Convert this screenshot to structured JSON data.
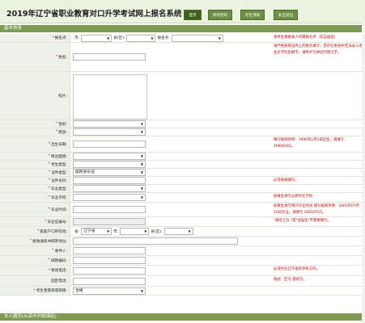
{
  "header": {
    "title": "2019年辽宁省职业教育对口升学考试网上报名系统",
    "nav": [
      "首页",
      "修改密码",
      "考生须知",
      "安全退出"
    ]
  },
  "sections": {
    "basic": "基本信息",
    "resume": "本人履历(从高中开始填起)"
  },
  "fields": {
    "site": {
      "label": "报名点:",
      "city_label": "市:",
      "county_label": "县(区):",
      "point_label": "报名点:"
    },
    "name": {
      "label": "姓名:"
    },
    "photo": {
      "label": "照片:"
    },
    "gender": {
      "label": "性别:"
    },
    "ethnicity": {
      "label": "民族:"
    },
    "birth": {
      "label": "出生日期:"
    },
    "politics": {
      "label": "政治面貌:"
    },
    "candidate_type": {
      "label": "考生类型:"
    },
    "id_type": {
      "label": "证件类型:",
      "value": "居民身份证"
    },
    "id_number": {
      "label": "证件号码:"
    },
    "grad_type": {
      "label": "毕业类型:"
    },
    "grad_school": {
      "label": "毕业学校:"
    },
    "grad_time": {
      "label": "毕业时间:"
    },
    "grad_cert": {
      "label": "毕业证编号:"
    },
    "hukou": {
      "label": "家庭户口所在地:",
      "province": "省:",
      "province_value": "辽宁省",
      "city_label": "市:",
      "county_label": "县(区):"
    },
    "address": {
      "label": "接收通知书邮寄地址:"
    },
    "recipient": {
      "label": "收件人:"
    },
    "postcode": {
      "label": "邮政编码:"
    },
    "mobile": {
      "label": "移动电话:"
    },
    "phone": {
      "label": "固定电话:"
    },
    "health": {
      "label": "考生患疾病或病情:",
      "value": "合格"
    }
  },
  "notes": {
    "site": "请考生根据本人所属报名点（非自由选）",
    "name": "请严格按照证件上的姓名填写，若存在系统中无法录入考生名字的生僻字，请用大写拼音代替汉字。",
    "birth": "填写规则举例：1990年1月1日出生，请填写19900101。",
    "id_number": "必须准确填写。",
    "grad_school": "如果生源写与原所在学校",
    "grad_time": "如果生源写预计毕业时间 填写规则举例：2001年07月15日毕业，请填写 20010715。",
    "grad_cert": "\"请近士兵 \"或\"往届生\"不需要填写。",
    "mobile": "必须为在辽宁省的手机号码。",
    "phone": "格式：区号-座机号。"
  },
  "colors": {
    "nav_bg": "#6e8f43",
    "section_bg": "#7d9c52",
    "required": "#d40000",
    "note_text": "#d40000"
  }
}
